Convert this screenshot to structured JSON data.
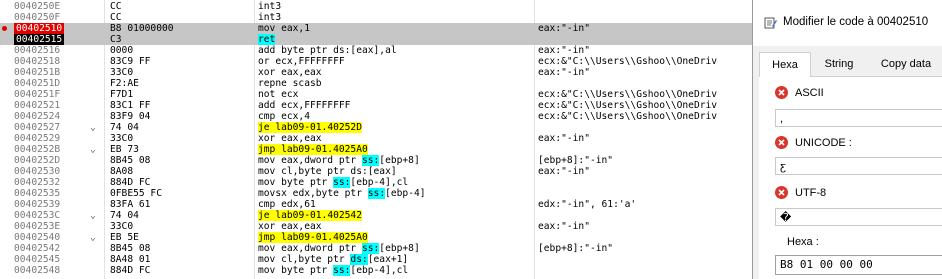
{
  "disasm": {
    "rows": [
      {
        "addr": "0040250E",
        "arrow": "",
        "bytes": "CC",
        "mn": "int3",
        "ops": [],
        "cmt": "",
        "style": ""
      },
      {
        "addr": "0040250F",
        "arrow": "",
        "bytes": "CC",
        "mn": "int3",
        "ops": [],
        "cmt": "",
        "style": ""
      },
      {
        "addr": "00402510",
        "arrow": "",
        "bytes": "B8 01000000",
        "mn": "mov",
        "ops": [
          {
            "t": " eax,1"
          }
        ],
        "cmt": "eax:\"-in\"",
        "style": "bp"
      },
      {
        "addr": "00402515",
        "arrow": "",
        "bytes": "C3",
        "mn": "ret",
        "ops": [],
        "cmt": "",
        "style": "eip"
      },
      {
        "addr": "00402516",
        "arrow": "",
        "bytes": "0000",
        "mn": "add",
        "ops": [
          {
            "t": " byte ptr ds:[eax],al"
          }
        ],
        "cmt": "eax:\"-in\"",
        "style": ""
      },
      {
        "addr": "00402518",
        "arrow": "",
        "bytes": "83C9 FF",
        "mn": "or",
        "ops": [
          {
            "t": " ecx,FFFFFFFF"
          }
        ],
        "cmt": "ecx:&\"C:\\\\Users\\\\Gshoo\\\\OneDriv",
        "style": ""
      },
      {
        "addr": "0040251B",
        "arrow": "",
        "bytes": "33C0",
        "mn": "xor",
        "ops": [
          {
            "t": " eax,eax"
          }
        ],
        "cmt": "eax:\"-in\"",
        "style": ""
      },
      {
        "addr": "0040251D",
        "arrow": "",
        "bytes": "F2:AE",
        "mn": "repne scasb",
        "ops": [],
        "cmt": "",
        "style": ""
      },
      {
        "addr": "0040251F",
        "arrow": "",
        "bytes": "F7D1",
        "mn": "not",
        "ops": [
          {
            "t": " ecx"
          }
        ],
        "cmt": "ecx:&\"C:\\\\Users\\\\Gshoo\\\\OneDriv",
        "style": ""
      },
      {
        "addr": "00402521",
        "arrow": "",
        "bytes": "83C1 FF",
        "mn": "add",
        "ops": [
          {
            "t": " ecx,FFFFFFFF"
          }
        ],
        "cmt": "ecx:&\"C:\\\\Users\\\\Gshoo\\\\OneDriv",
        "style": ""
      },
      {
        "addr": "00402524",
        "arrow": "",
        "bytes": "83F9 04",
        "mn": "cmp",
        "ops": [
          {
            "t": " ecx,4"
          }
        ],
        "cmt": "ecx:&\"C:\\\\Users\\\\Gshoo\\\\OneDriv",
        "style": ""
      },
      {
        "addr": "00402527",
        "arrow": "⌄",
        "bytes": "74 04",
        "mn": "je",
        "mnhl": "y",
        "ops": [
          {
            "t": " lab09-01.40252D",
            "hl": "y"
          }
        ],
        "cmt": "",
        "style": ""
      },
      {
        "addr": "00402529",
        "arrow": "",
        "bytes": "33C0",
        "mn": "xor",
        "ops": [
          {
            "t": " eax,eax"
          }
        ],
        "cmt": "eax:\"-in\"",
        "style": ""
      },
      {
        "addr": "0040252B",
        "arrow": "⌄",
        "bytes": "EB 73",
        "mn": "jmp",
        "mnhl": "y",
        "ops": [
          {
            "t": " lab09-01.4025A0",
            "hl": "y"
          }
        ],
        "cmt": "",
        "style": ""
      },
      {
        "addr": "0040252D",
        "arrow": "",
        "bytes": "8B45 08",
        "mn": "mov",
        "ops": [
          {
            "t": " eax,dword ptr "
          },
          {
            "t": "ss:",
            "hl": "c"
          },
          {
            "t": "[ebp+8]"
          }
        ],
        "cmt": "[ebp+8]:\"-in\"",
        "style": ""
      },
      {
        "addr": "00402530",
        "arrow": "",
        "bytes": "8A08",
        "mn": "mov",
        "ops": [
          {
            "t": " cl,byte ptr ds:[eax]"
          }
        ],
        "cmt": "eax:\"-in\"",
        "style": ""
      },
      {
        "addr": "00402532",
        "arrow": "",
        "bytes": "884D FC",
        "mn": "mov",
        "ops": [
          {
            "t": " byte ptr "
          },
          {
            "t": "ss:",
            "hl": "c"
          },
          {
            "t": "[ebp-4],cl"
          }
        ],
        "cmt": "",
        "style": ""
      },
      {
        "addr": "00402535",
        "arrow": "",
        "bytes": "0FBE55 FC",
        "mn": "movsx",
        "ops": [
          {
            "t": " edx,byte ptr "
          },
          {
            "t": "ss:",
            "hl": "c"
          },
          {
            "t": "[ebp-4]"
          }
        ],
        "cmt": "",
        "style": ""
      },
      {
        "addr": "00402539",
        "arrow": "",
        "bytes": "83FA 61",
        "mn": "cmp",
        "ops": [
          {
            "t": " edx,61"
          }
        ],
        "cmt": "edx:\"-in\", 61:'a'",
        "style": ""
      },
      {
        "addr": "0040253C",
        "arrow": "⌄",
        "bytes": "74 04",
        "mn": "je",
        "mnhl": "y",
        "ops": [
          {
            "t": " lab09-01.402542",
            "hl": "y"
          }
        ],
        "cmt": "",
        "style": ""
      },
      {
        "addr": "0040253E",
        "arrow": "",
        "bytes": "33C0",
        "mn": "xor",
        "ops": [
          {
            "t": " eax,eax"
          }
        ],
        "cmt": "eax:\"-in\"",
        "style": ""
      },
      {
        "addr": "00402540",
        "arrow": "⌄",
        "bytes": "EB 5E",
        "mn": "jmp",
        "mnhl": "y",
        "ops": [
          {
            "t": " lab09-01.4025A0",
            "hl": "y"
          }
        ],
        "cmt": "",
        "style": ""
      },
      {
        "addr": "00402542",
        "arrow": "",
        "bytes": "8B45 08",
        "mn": "mov",
        "ops": [
          {
            "t": " eax,dword ptr "
          },
          {
            "t": "ss:",
            "hl": "c"
          },
          {
            "t": "[ebp+8]"
          }
        ],
        "cmt": "[ebp+8]:\"-in\"",
        "style": ""
      },
      {
        "addr": "00402545",
        "arrow": "",
        "bytes": "8A48 01",
        "mn": "mov",
        "ops": [
          {
            "t": " cl,byte ptr "
          },
          {
            "t": "ds:",
            "hl": "c"
          },
          {
            "t": "[eax+1]"
          }
        ],
        "cmt": "",
        "style": ""
      },
      {
        "addr": "00402548",
        "arrow": "",
        "bytes": "884D FC",
        "mn": "mov",
        "ops": [
          {
            "t": " byte ptr "
          },
          {
            "t": "ss:",
            "hl": "c"
          },
          {
            "t": "[ebp-4],cl"
          }
        ],
        "cmt": "",
        "style": ""
      }
    ]
  },
  "dialog": {
    "title": "Modifier le code à 00402510",
    "tabs": {
      "hexa": "Hexa",
      "string": "String",
      "copy": "Copy data"
    },
    "ascii": {
      "label": "ASCII",
      "value": ","
    },
    "unicode": {
      "label": "UNICODE :",
      "value": "ƹ"
    },
    "utf8": {
      "label": "UTF-8",
      "value": "�"
    },
    "hexa": {
      "label": "Hexa :",
      "value": "B8 01 00 00 00"
    }
  }
}
